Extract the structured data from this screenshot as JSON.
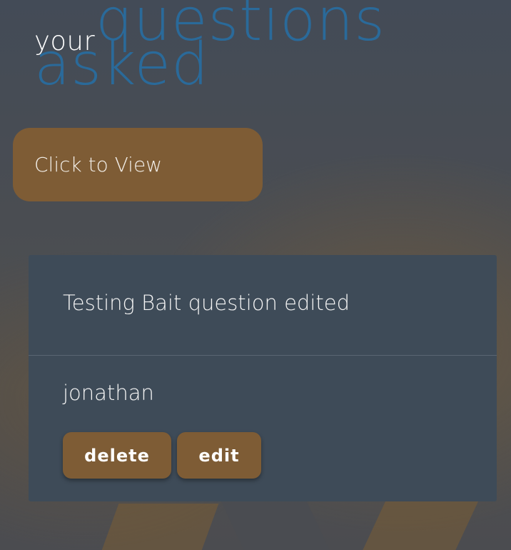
{
  "header": {
    "title_word_1": "your",
    "title_word_2": "questions",
    "title_word_3": "asked"
  },
  "view_button": {
    "label": "Click to View"
  },
  "question_card": {
    "question_text": "Testing Bait question edited",
    "author": "jonathan",
    "delete_label": "delete",
    "edit_label": "edit"
  },
  "colors": {
    "accent_brown": "#7e5c35",
    "title_blue": "#2a6a9a",
    "card_bg": "#3e4b58"
  }
}
